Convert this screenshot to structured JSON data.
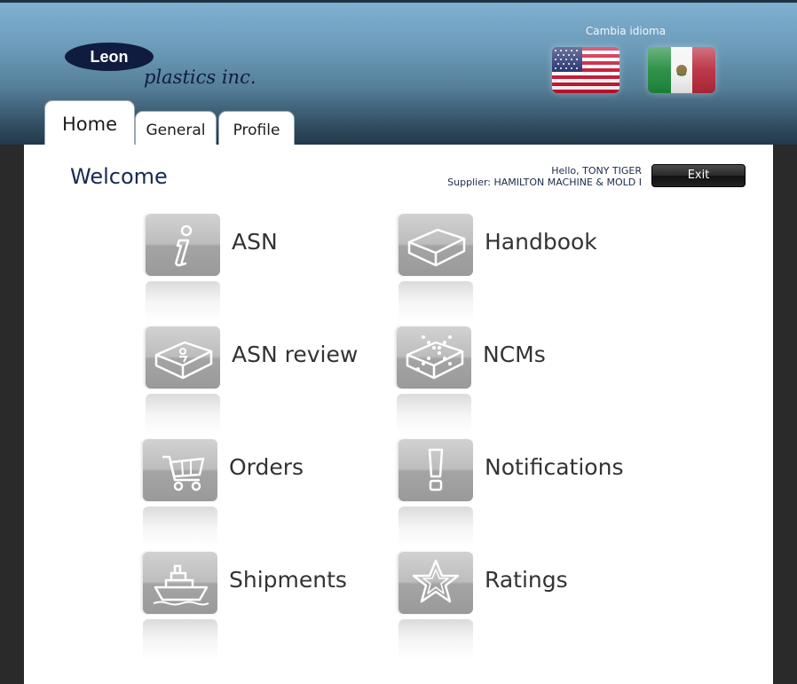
{
  "header": {
    "logo_text_top": "Leon",
    "logo_text_bottom": "plastics inc.",
    "language_label": "Cambia idioma",
    "languages": [
      {
        "name": "us-flag-icon"
      },
      {
        "name": "mexico-flag-icon"
      }
    ]
  },
  "tabs": [
    {
      "label": "Home"
    },
    {
      "label": "General"
    },
    {
      "label": "Profile"
    }
  ],
  "main": {
    "welcome": "Welcome",
    "greeting": "Hello, TONY TIGER",
    "supplier": "Supplier: HAMILTON MACHINE & MOLD I",
    "exit_label": "Exit",
    "menu": [
      {
        "label": "ASN",
        "icon": "info-icon"
      },
      {
        "label": "Handbook",
        "icon": "box-icon"
      },
      {
        "label": "ASN review",
        "icon": "box-review-icon"
      },
      {
        "label": "NCMs",
        "icon": "box-cross-icon"
      },
      {
        "label": "Orders",
        "icon": "cart-icon"
      },
      {
        "label": "Notifications",
        "icon": "exclamation-icon"
      },
      {
        "label": "Shipments",
        "icon": "ship-icon"
      },
      {
        "label": "Ratings",
        "icon": "star-icon"
      }
    ]
  },
  "colors": {
    "header_top": "#7fb0cf",
    "header_bottom": "#22394a",
    "frame": "#2a2a2a",
    "welcome_text": "#172a54",
    "tile": "#b4b4b4"
  }
}
